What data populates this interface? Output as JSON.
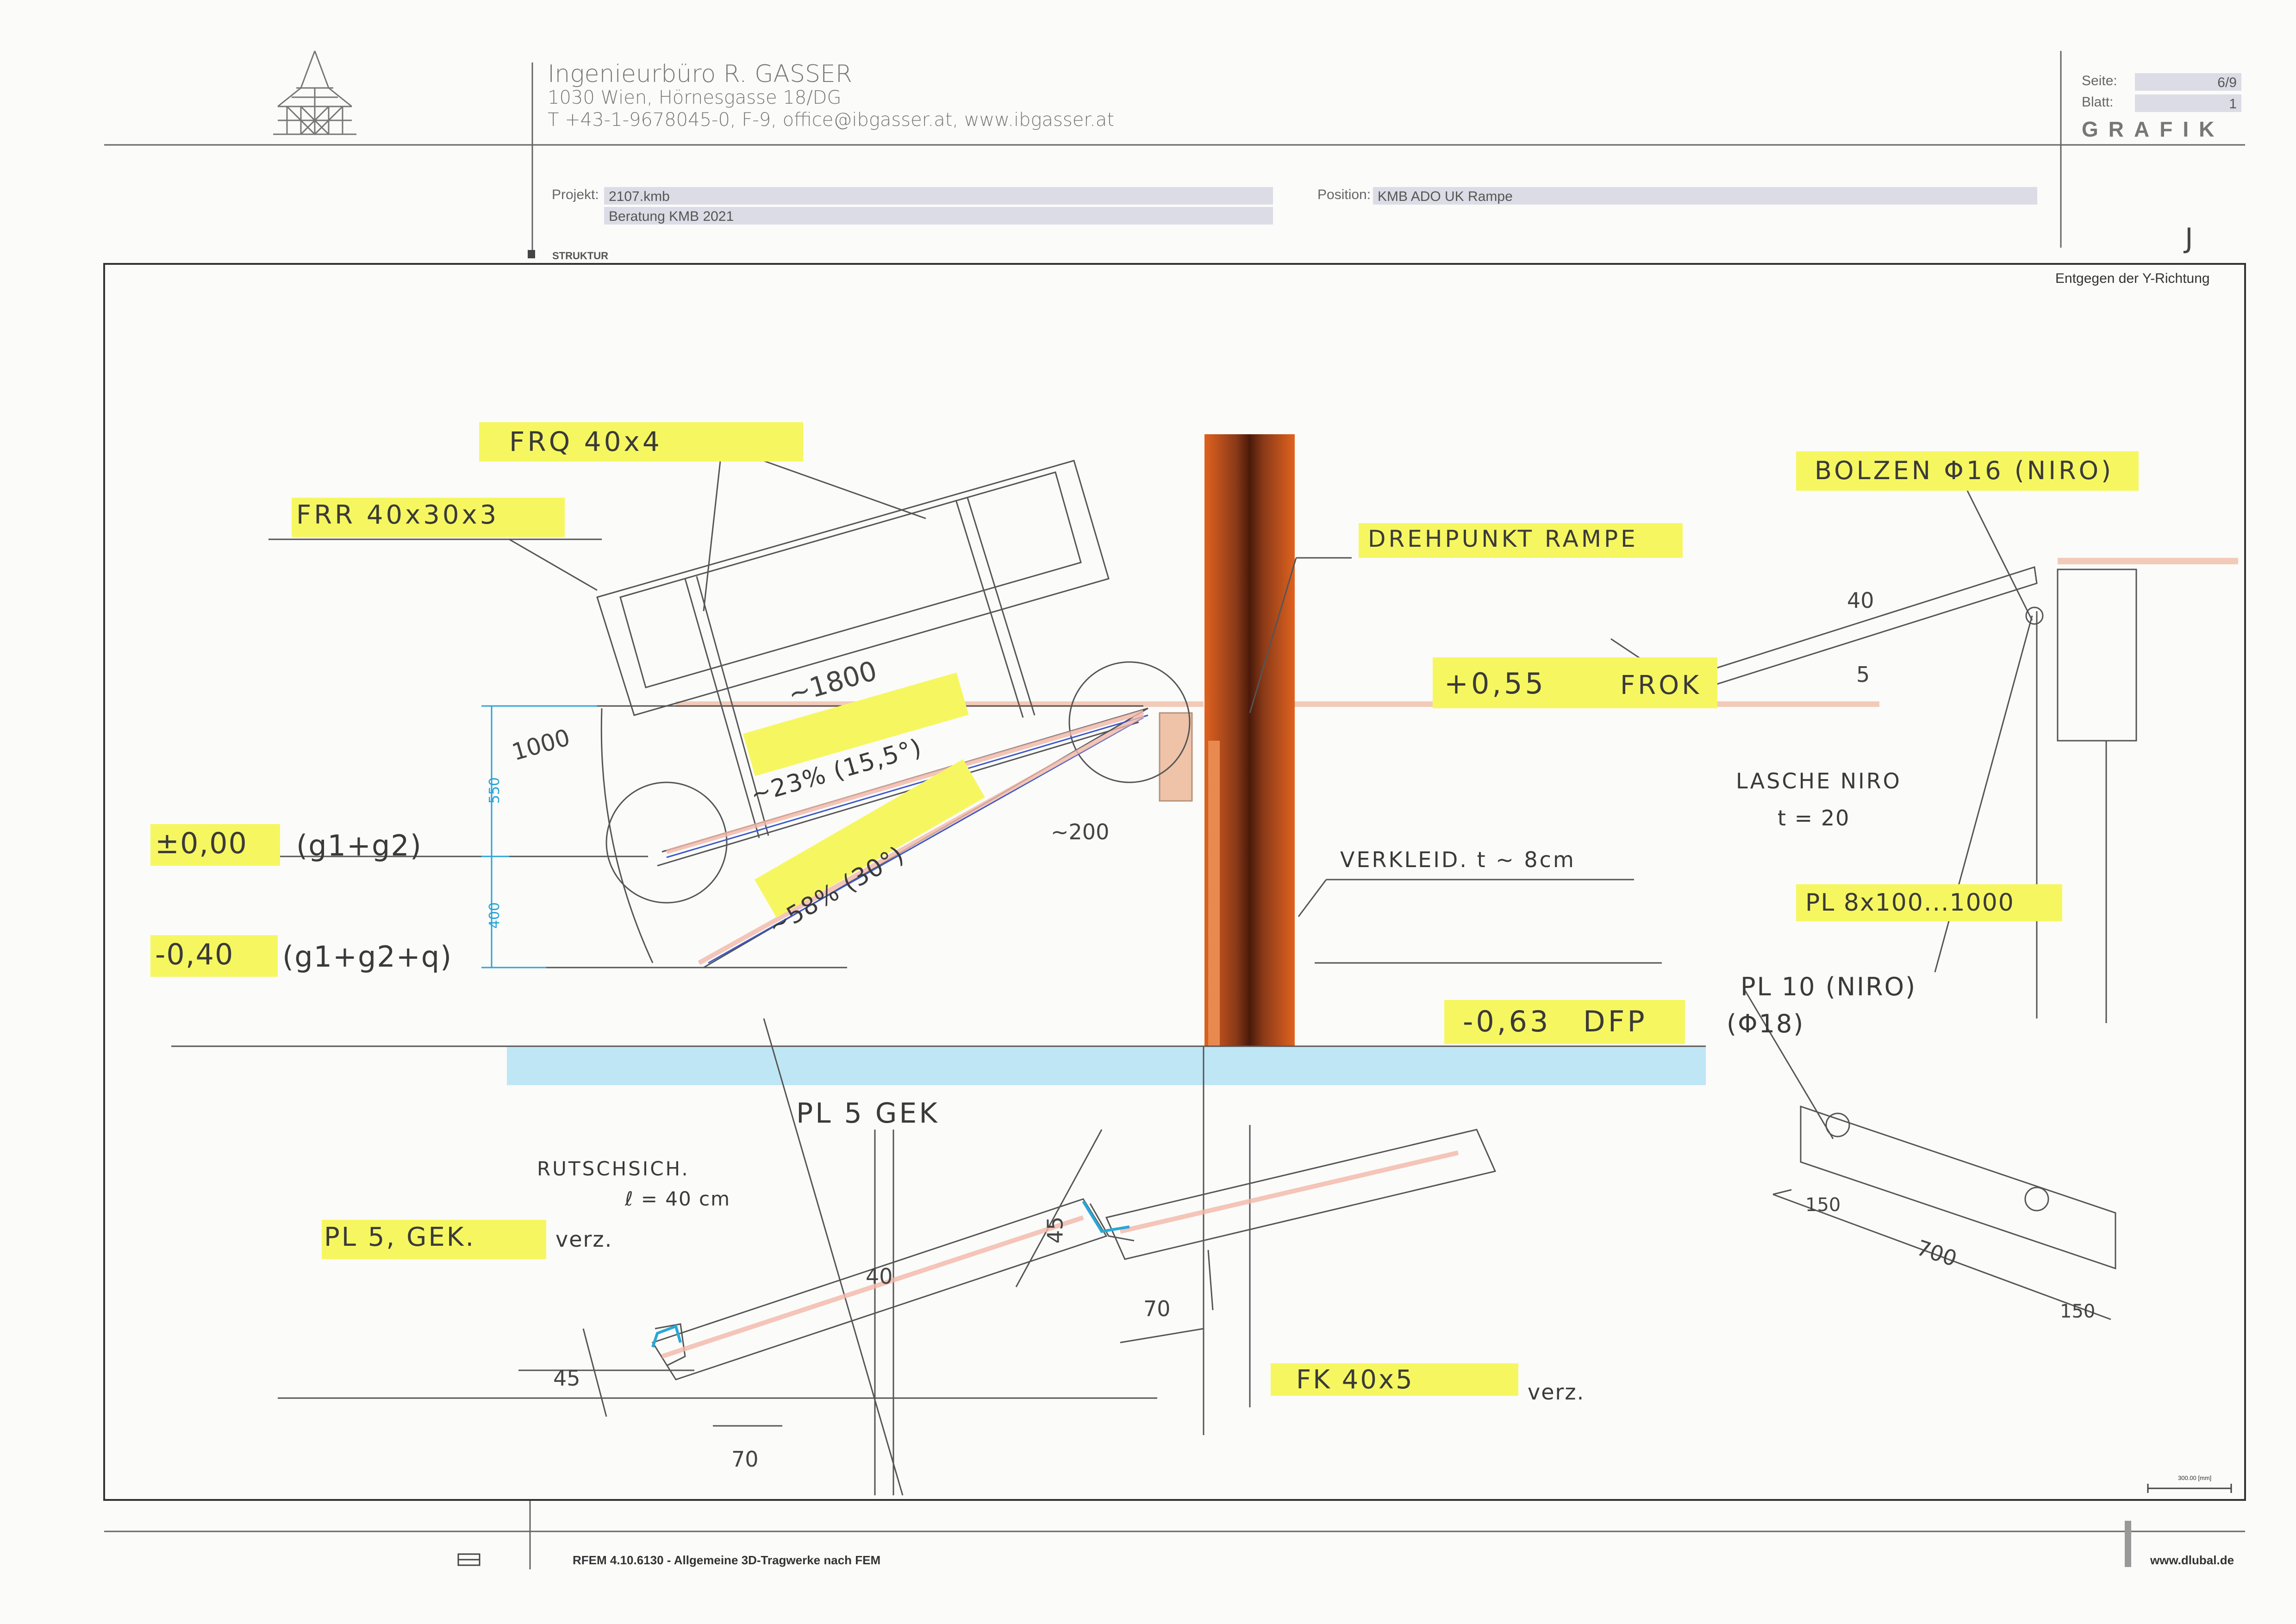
{
  "header": {
    "company_name": "Ingenieurbüro R. GASSER",
    "company_address": "1030 Wien, Hörnesgasse 18/DG",
    "company_contact": "T +43-1-9678045-0,  F-9,  office@ibgasser.at,  www.ibgasser.at",
    "seite_label": "Seite:",
    "seite_value": "6/9",
    "blatt_label": "Blatt:",
    "blatt_value": "1",
    "section_title": "GRAFIK"
  },
  "project": {
    "projekt_label": "Projekt:",
    "projekt_value": "2107.kmb",
    "projekt_desc": "Beratung KMB 2021",
    "position_label": "Position:",
    "position_value": "KMB ADO UK Rampe",
    "struktur_label": "STRUKTUR"
  },
  "drawing": {
    "direction_note": "Entgegen der Y-Richtung",
    "scale_label": "300.00 [mm]",
    "annotations": {
      "frq": "FRQ 40x4",
      "frr": "FRR 40x30x3",
      "bolzen": "BOLZEN Φ16 (NIRO)",
      "drehpunkt": "DREHPUNKT RAMPE",
      "plus055": "+0,55",
      "fok": "FROK",
      "lasche": "LASCHE NIRO",
      "lasche_t": "t = 20",
      "pl8": "PL 8x100...1000",
      "verkleid": "VERKLEID. t ~ 8cm",
      "pl10": "PL 10 (NIRO)",
      "phi18": "(Φ18)",
      "minus063": "-0,63",
      "dfp": "DFP",
      "zero": "±0,00",
      "zero_loads": "(g1+g2)",
      "minus040": "-0,40",
      "minus040_loads": "(g1+g2+q)",
      "slope1": "~23% (15,5°)",
      "slope2": "~58% (30°)",
      "len1800": "~1800",
      "len1000": "1000",
      "approx200": "~200",
      "dim550": "550",
      "dim400": "400",
      "dim40": "40",
      "dim5": "5",
      "pl5_gek_top": "PL 5 GEK",
      "rutsch": "RUTSCHSICH.",
      "rutsch_l": "ℓ = 40 cm",
      "pl5_gek": "PL 5, GEK.",
      "verz": "verz.",
      "d40": "40",
      "d45": "45",
      "d70a": "70",
      "d70b": "70",
      "d45b": "45",
      "fk": "FK 40x5",
      "fk_verz": "verz.",
      "d150a": "150",
      "d700": "700",
      "d150b": "150",
      "mark_j": "J"
    }
  },
  "footer": {
    "software": "RFEM 4.10.6130 - Allgemeine 3D-Tragwerke nach FEM",
    "website": "www.dlubal.de"
  }
}
